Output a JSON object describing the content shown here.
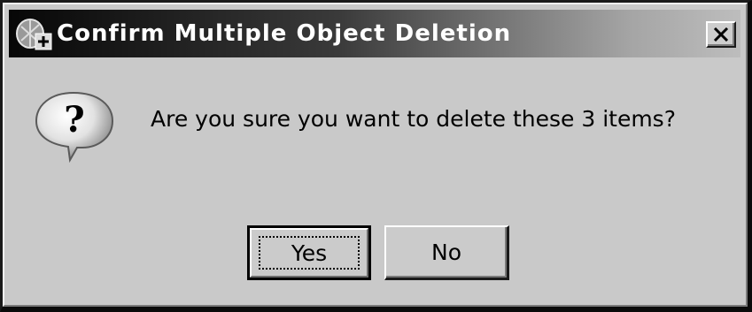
{
  "window": {
    "title": "Confirm Multiple Object Deletion",
    "app_icon": "app-icon",
    "close_label": "X"
  },
  "dialog": {
    "icon": "question-icon",
    "icon_glyph": "?",
    "message": "Are you sure you want to delete these 3 items?"
  },
  "buttons": {
    "yes": "Yes",
    "no": "No"
  },
  "colors": {
    "face": "#c9c9c9",
    "title_start": "#070707",
    "title_end": "#bdbdbd",
    "title_text": "#ffffff"
  }
}
